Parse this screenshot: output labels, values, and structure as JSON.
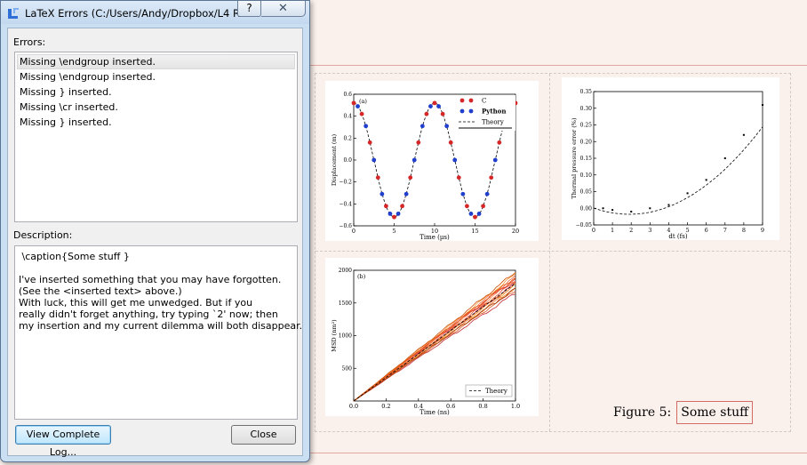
{
  "dialog": {
    "title": "LaTeX Errors (C:/Users/Andy/Dropbox/L4 R...",
    "help_label": "?",
    "close_label": "✕",
    "errors_label": "Errors:",
    "errors": [
      "Missing \\endgroup inserted.",
      "Missing \\endgroup inserted.",
      "Missing } inserted.",
      "Missing \\cr inserted.",
      "Missing } inserted."
    ],
    "selected_error_index": 0,
    "description_label": "Description:",
    "description": " \\caption{Some stuff }\n\nI've inserted something that you may have forgotten.\n(See the <inserted text> above.)\nWith luck, this will get me unwedged. But if you\nreally didn't forget anything, try typing `2' now; then\nmy insertion and my current dilemma will both disappear.",
    "view_log_label": "View Complete Log...",
    "close_button_label": "Close",
    "icons": {
      "app": "latex-app-icon",
      "help": "help-icon",
      "close": "close-icon"
    }
  },
  "figure": {
    "caption_prefix": "Figure 5:",
    "caption_text": "Some stuff"
  },
  "chart_data": [
    {
      "type": "scatter",
      "panel_label": "(a)",
      "xlabel": "Time (µs)",
      "ylabel": "Displacement (m)",
      "xlim": [
        0,
        20
      ],
      "ylim": [
        -0.6,
        0.6
      ],
      "x_ticks": [
        "0",
        "5",
        "10",
        "15",
        "20"
      ],
      "y_ticks": [
        "−0.6",
        "−0.4",
        "−0.2",
        "0.0",
        "0.2",
        "0.4",
        "0.6"
      ],
      "legend": [
        "C",
        "Python",
        "Theory"
      ],
      "legend_position": "top-right",
      "theory_amplitude": 0.52,
      "theory_period": 10,
      "series": [
        {
          "name": "C",
          "color": "#d62728",
          "x": [
            0.0,
            1.0,
            2.0,
            3.0,
            4.0,
            5.0,
            6.0,
            7.0,
            8.0,
            9.0,
            10.0,
            11.0,
            12.0,
            13.0,
            14.0,
            15.0,
            16.0,
            17.0,
            18.0,
            19.0,
            20.0
          ],
          "y": [
            0.52,
            0.42,
            0.16,
            -0.16,
            -0.42,
            -0.52,
            -0.42,
            -0.16,
            0.16,
            0.42,
            0.52,
            0.42,
            0.16,
            -0.16,
            -0.42,
            -0.52,
            -0.42,
            -0.16,
            0.16,
            0.42,
            0.52
          ]
        },
        {
          "name": "Python",
          "color": "#1f3fcc",
          "x": [
            0.5,
            1.5,
            2.5,
            3.5,
            4.5,
            5.5,
            6.5,
            7.5,
            8.5,
            9.5,
            10.5,
            11.5,
            12.5,
            13.5,
            14.5,
            15.5,
            16.5,
            17.5,
            18.5,
            19.5
          ],
          "y": [
            0.49,
            0.31,
            0.0,
            -0.31,
            -0.49,
            -0.49,
            -0.31,
            0.0,
            0.31,
            0.49,
            0.49,
            0.31,
            0.0,
            -0.31,
            -0.49,
            -0.49,
            -0.31,
            0.0,
            0.31,
            0.49
          ]
        }
      ]
    },
    {
      "type": "scatter",
      "xlabel": "dt (fs)",
      "ylabel": "Thermal pressure error (%)",
      "xlim": [
        0,
        9
      ],
      "ylim": [
        -0.05,
        0.35
      ],
      "x_ticks": [
        "0",
        "1",
        "2",
        "3",
        "4",
        "5",
        "6",
        "7",
        "8",
        "9"
      ],
      "y_ticks": [
        "−0.05",
        "0.00",
        "0.05",
        "0.10",
        "0.15",
        "0.20",
        "0.25",
        "0.30",
        "0.35"
      ],
      "series": [
        {
          "name": "",
          "x": [
            0.5,
            1,
            2,
            3,
            4,
            5,
            6,
            7,
            8,
            9
          ],
          "y": [
            0.0,
            -0.005,
            -0.01,
            0.0,
            0.01,
            0.045,
            0.085,
            0.15,
            0.22,
            0.31
          ]
        }
      ]
    },
    {
      "type": "line",
      "panel_label": "(b)",
      "xlabel": "Time (ns)",
      "ylabel": "MSD (nm²)",
      "xlim": [
        0,
        1.0
      ],
      "ylim": [
        0,
        2000
      ],
      "x_ticks": [
        "0.0",
        "0.2",
        "0.4",
        "0.6",
        "0.8",
        "1.0"
      ],
      "y_ticks": [
        "500",
        "1000",
        "1500",
        "2000"
      ],
      "legend": [
        "Theory"
      ],
      "legend_position": "bottom-right",
      "series_end_values": [
        1650,
        1700,
        1740,
        1780,
        1800,
        1830,
        1860,
        1880,
        1910,
        1940,
        1970,
        1900,
        1790,
        1720
      ],
      "theory_slope": 1800
    }
  ]
}
